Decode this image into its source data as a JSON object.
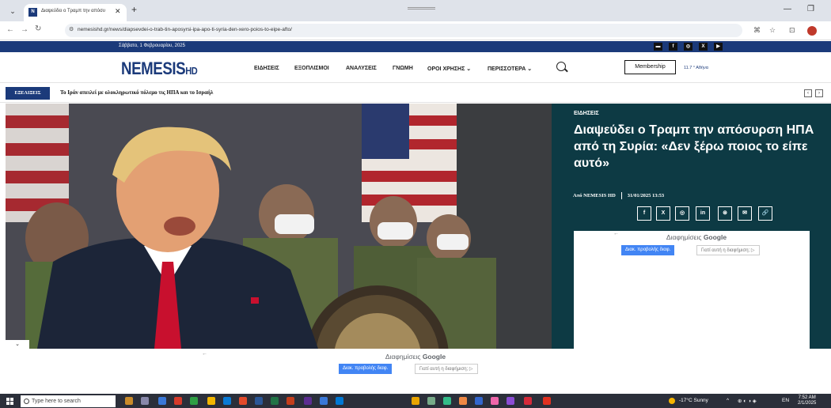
{
  "browser": {
    "tab_title": "Διαψεύδει ο Τραμπ την απόσυ",
    "favicon_letters": "N",
    "url": "nemesishd.gr/news/diapsevdei-o-trab-tin-aposyrsi-ipa-apo-ti-syria-den-xero-poios-to-eipe-afto/"
  },
  "site": {
    "date": "Σάββατο, 1 Φεβρουαρίου, 2025",
    "logo_main": "NEMESIS",
    "logo_suffix": "HD",
    "menu": [
      "ΕΙΔΗΣΕΙΣ",
      "ΕΞΟΠΛΙΣΜΟΙ",
      "ΑΝΑΛΥΣΕΙΣ",
      "ΓΝΩΜΗ",
      "ΟΡΟΙ ΧΡΗΣΗΣ ⌄",
      "ΠΕΡΙΣΣΟΤΕΡΑ ⌄"
    ],
    "membership": "Membership",
    "weather": "11.7 ° Αθήνα",
    "social_icons": [
      "rss-icon",
      "facebook-icon",
      "instagram-icon",
      "x-icon",
      "youtube-icon"
    ]
  },
  "ticker": {
    "label": "ΕΞΕΛΙΞΕΙΣ",
    "text": "Το Ιράν απειλεί με ολοκληρωτικό πόλεμο τις ΗΠΑ και το Ισραήλ"
  },
  "article": {
    "category": "ΕΙΔΗΣΕΙΣ",
    "headline": "Διαψεύδει ο Τραμπ την απόσυρση ΗΠΑ από τη Συρία: «Δεν ξέρω ποιος το είπε αυτό»",
    "author": "Από NEMESIS HD",
    "datetime": "31/01/2025 13:53",
    "share_buttons": [
      "f",
      "X",
      "◎",
      "in",
      "⊛",
      "✉",
      "🔗"
    ]
  },
  "ads": {
    "header_prefix": "Διαφημίσεις",
    "header_brand": "Google",
    "stop_label": "Διακ. προβολής διαφ.",
    "why_label": "Γιατί αυτή η διαφήμιση; ▷"
  },
  "taskbar": {
    "search_placeholder": "Type here to search",
    "weather": "-17°C Sunny",
    "lang": "EN",
    "time": "7:52 AM",
    "date": "2/1/2025"
  },
  "colors": {
    "brand_blue": "#1b3a7a",
    "panel_teal": "#0d3a44",
    "ad_blue": "#4285f4"
  }
}
